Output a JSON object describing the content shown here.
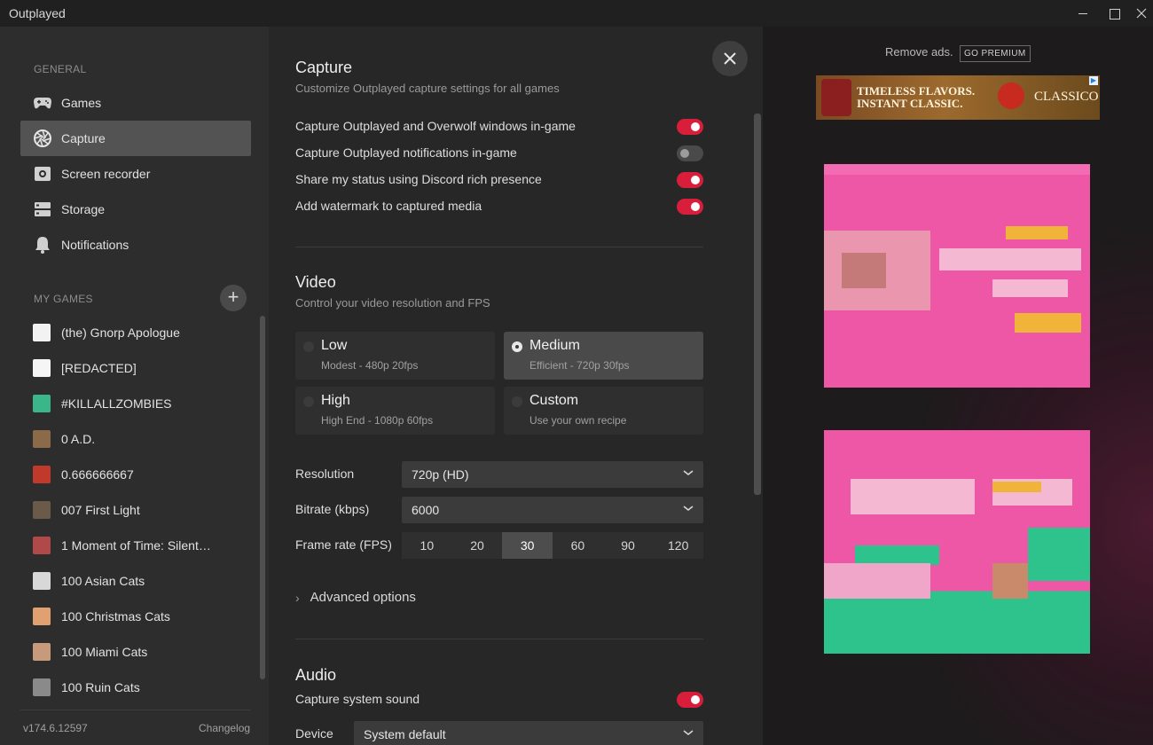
{
  "window": {
    "title": "Outplayed"
  },
  "sidebar": {
    "general_header": "GENERAL",
    "nav": [
      {
        "label": "Games",
        "icon": "gamepad-icon"
      },
      {
        "label": "Capture",
        "icon": "aperture-icon",
        "active": true
      },
      {
        "label": "Screen recorder",
        "icon": "record-icon"
      },
      {
        "label": "Storage",
        "icon": "storage-icon"
      },
      {
        "label": "Notifications",
        "icon": "bell-icon"
      }
    ],
    "my_games_header": "MY GAMES",
    "add_symbol": "+",
    "games": [
      "(the) Gnorp Apologue",
      "[REDACTED]",
      "#KILLALLZOMBIES",
      "0 A.D.",
      "0.666666667",
      "007 First Light",
      "1 Moment of Time: Silent…",
      "100 Asian Cats",
      "100 Christmas Cats",
      "100 Miami Cats",
      "100 Ruin Cats"
    ],
    "game_icon_colors": [
      "#f2f2f2",
      "#f5f5f5",
      "#3bb58a",
      "#8a6a48",
      "#c0392b",
      "#6b5a4a",
      "#b04a4a",
      "#d8d8d8",
      "#e0a070",
      "#c69a7a",
      "#8a8a8a"
    ],
    "version": "v174.6.12597",
    "changelog": "Changelog"
  },
  "capture": {
    "title": "Capture",
    "subtitle": "Customize Outplayed capture settings for all games",
    "toggles": [
      {
        "label": "Capture Outplayed and Overwolf windows in-game",
        "on": true
      },
      {
        "label": "Capture Outplayed notifications in-game",
        "on": false
      },
      {
        "label": "Share my status using Discord rich presence",
        "on": true
      },
      {
        "label": "Add watermark to captured media",
        "on": true
      }
    ]
  },
  "video": {
    "title": "Video",
    "subtitle": "Control your video resolution and FPS",
    "qualities": [
      {
        "title": "Low",
        "desc": "Modest - 480p 20fps",
        "selected": false
      },
      {
        "title": "Medium",
        "desc": "Efficient - 720p 30fps",
        "selected": true
      },
      {
        "title": "High",
        "desc": "High End - 1080p 60fps",
        "selected": false
      },
      {
        "title": "Custom",
        "desc": "Use your own recipe",
        "selected": false
      }
    ],
    "resolution_label": "Resolution",
    "resolution_value": "720p (HD)",
    "bitrate_label": "Bitrate (kbps)",
    "bitrate_value": "6000",
    "framerate_label": "Frame rate (FPS)",
    "fps_options": [
      "10",
      "20",
      "30",
      "60",
      "90",
      "120"
    ],
    "fps_selected": "30",
    "advanced": "Advanced options"
  },
  "audio": {
    "title": "Audio",
    "capture_system_sound": "Capture system sound",
    "capture_system_sound_on": true,
    "device_label": "Device",
    "device_value": "System default"
  },
  "ads": {
    "remove_ads": "Remove ads.",
    "go_premium": "GO PREMIUM",
    "banner_line1": "TIMELESS FLAVORS.",
    "banner_line2": "INSTANT CLASSIC.",
    "banner_brand": "CLASSICO"
  }
}
